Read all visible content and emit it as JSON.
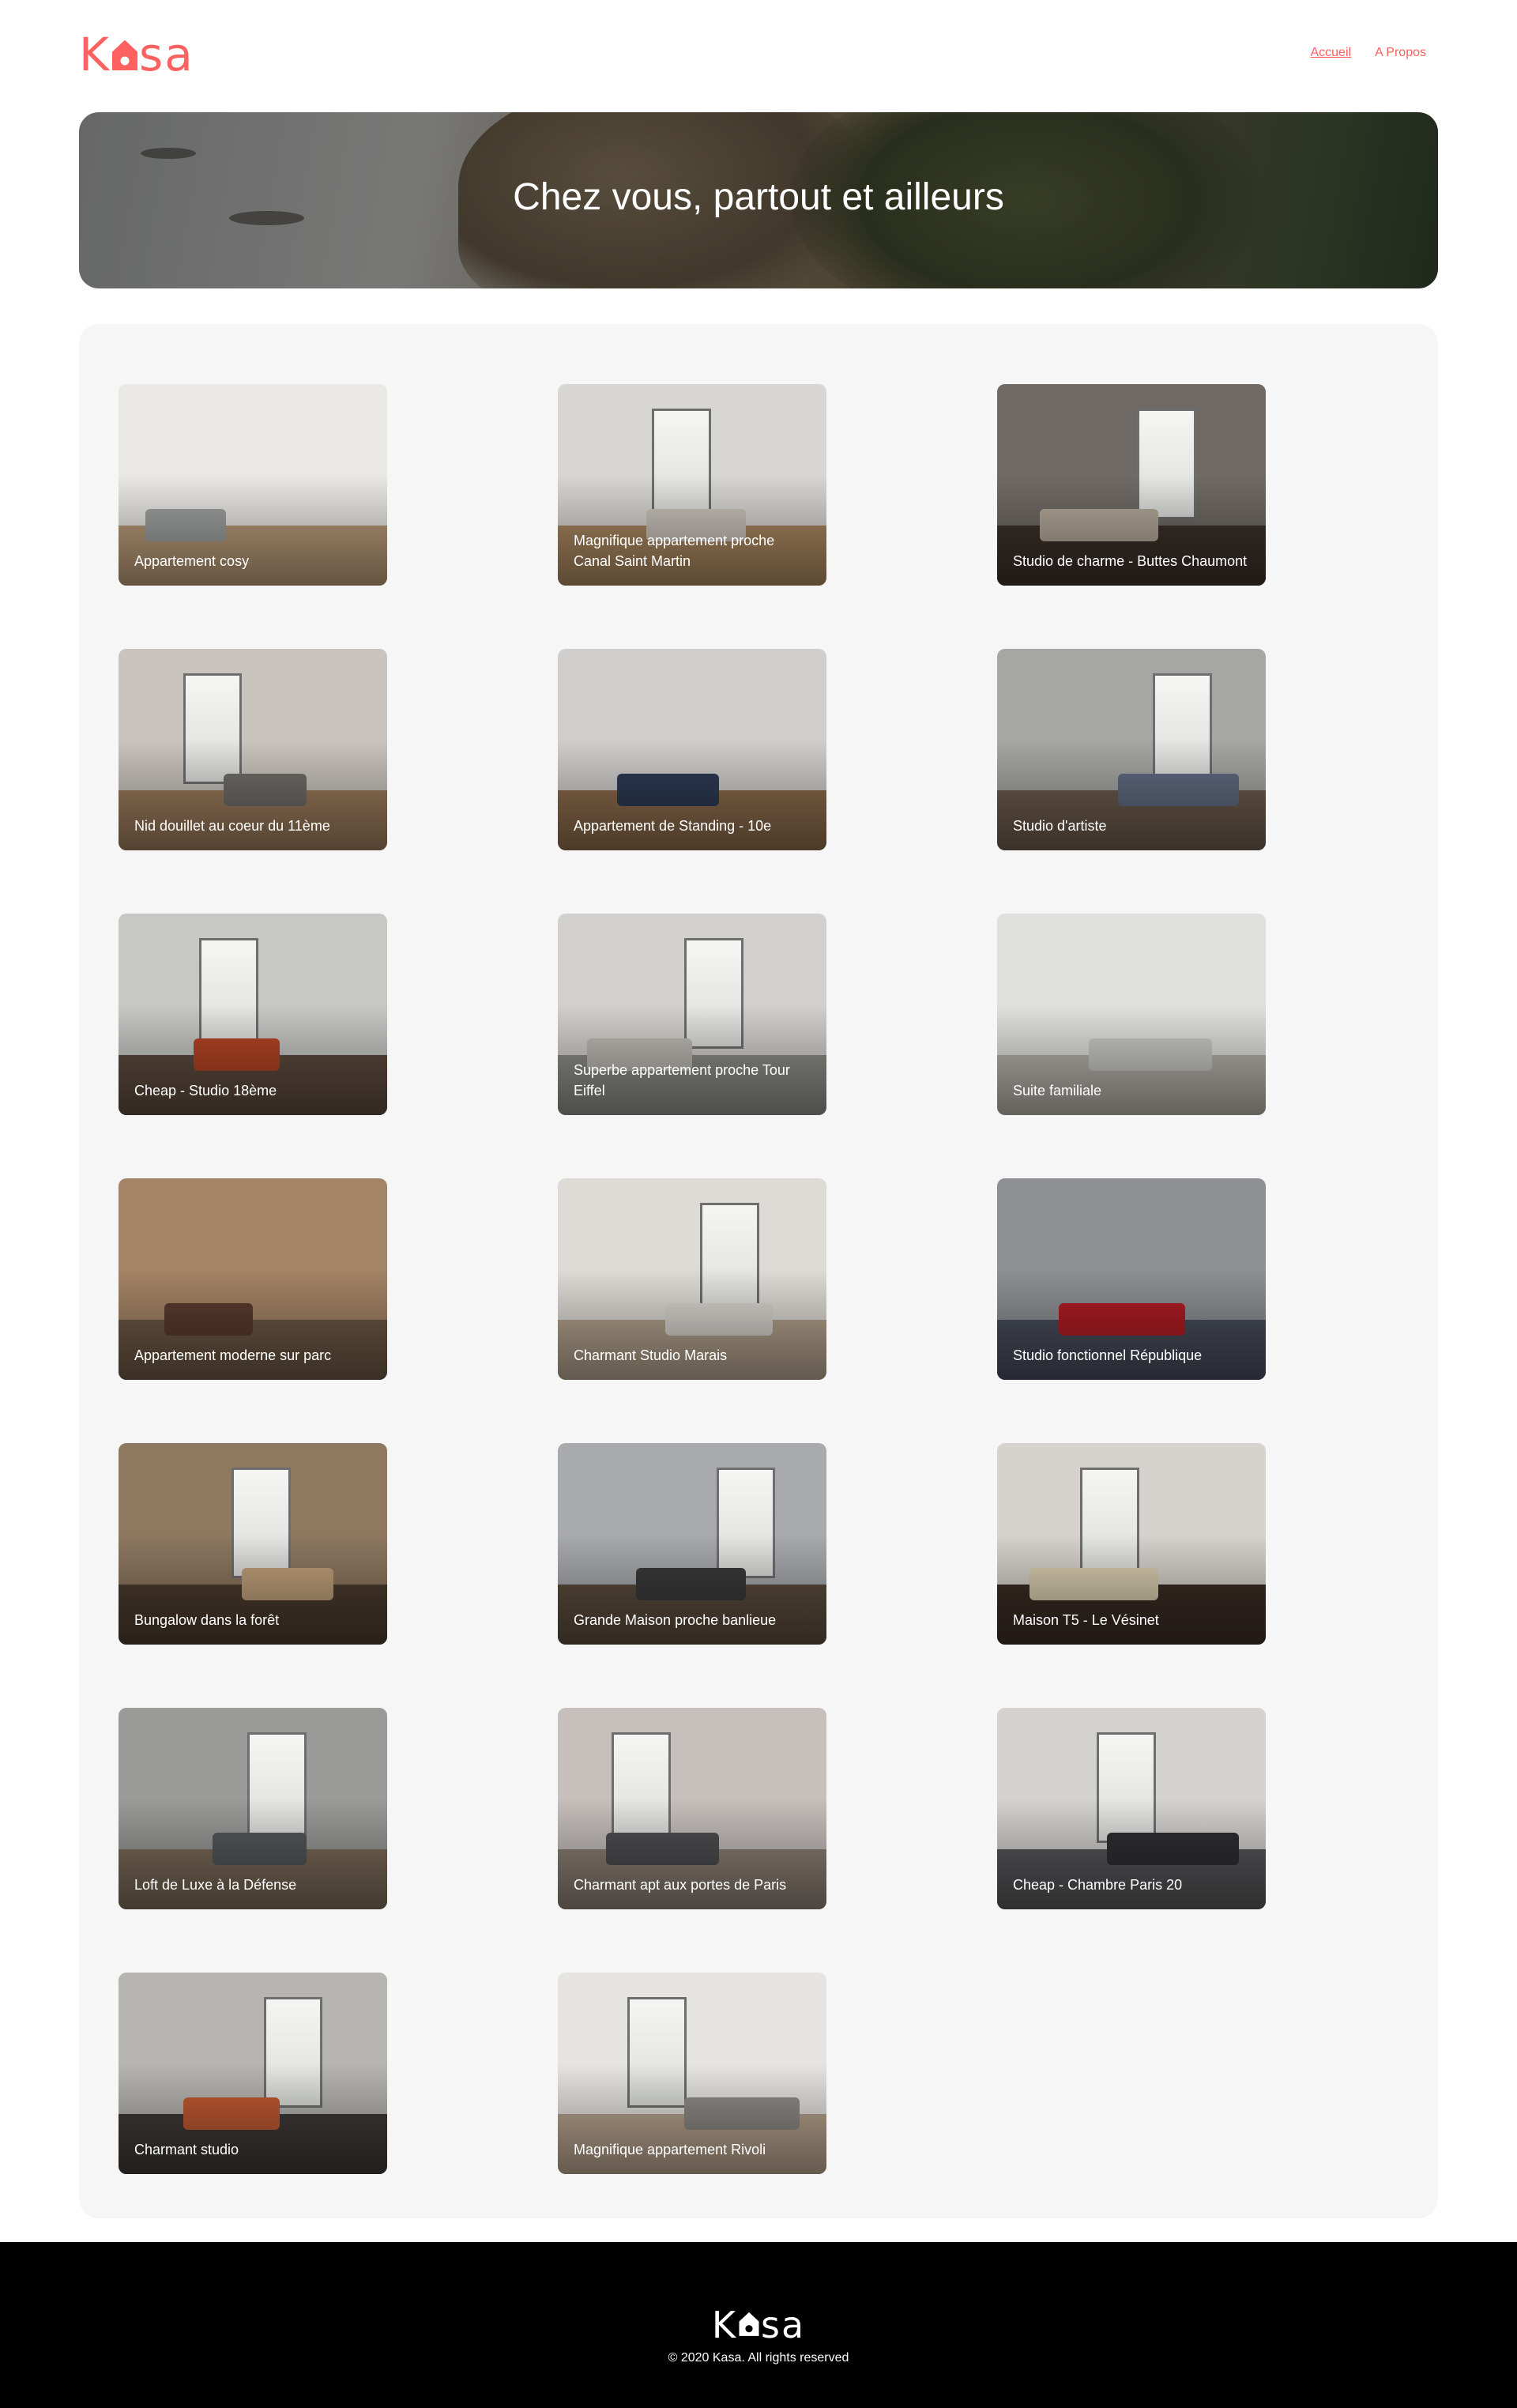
{
  "header": {
    "logo_text_k": "K",
    "logo_text_rest": "sa",
    "nav": [
      {
        "label": "Accueil",
        "active": true
      },
      {
        "label": "A Propos",
        "active": false
      }
    ]
  },
  "banner": {
    "title": "Chez vous, partout et ailleurs"
  },
  "gallery": {
    "items": [
      {
        "title": "Appartement cosy",
        "wall": "#e9e8e4",
        "floor": "#b99a78",
        "sofa": "#9ea1a0",
        "window": false
      },
      {
        "title": "Magnifique appartement proche Canal Saint Martin",
        "wall": "#d8d6d2",
        "floor": "#a8865f",
        "sofa": "#c9c3ba",
        "window": true
      },
      {
        "title": "Studio de charme - Buttes Chaumont",
        "wall": "#6f6a65",
        "floor": "#3b302a",
        "sofa": "#b3a89a",
        "window": true
      },
      {
        "title": "Nid douillet au coeur du 11ème",
        "wall": "#c9c4bd",
        "floor": "#9a7a5a",
        "sofa": "#6f6d69",
        "window": true
      },
      {
        "title": "Appartement de Standing - 10e",
        "wall": "#cfcecc",
        "floor": "#8a6a4a",
        "sofa": "#2d3a55",
        "window": false
      },
      {
        "title": "Studio d'artiste",
        "wall": "#a6a6a4",
        "floor": "#6b5a4c",
        "sofa": "#5f6b80",
        "window": true
      },
      {
        "title": "Cheap - Studio 18ème",
        "wall": "#c7c7c4",
        "floor": "#5c4a3e",
        "sofa": "#b44424",
        "window": true
      },
      {
        "title": "Superbe appartement proche Tour Eiffel",
        "wall": "#d2d0cc",
        "floor": "#8c8c86",
        "sofa": "#bdbab3",
        "window": true
      },
      {
        "title": "Suite familiale",
        "wall": "#e0e0de",
        "floor": "#b6b1aa",
        "sofa": "#c9c9c7",
        "window": false
      },
      {
        "title": "Appartement moderne sur parc",
        "wall": "#a48466",
        "floor": "#6b5743",
        "sofa": "#5a3b2e",
        "window": false
      },
      {
        "title": "Charmant Studio Marais",
        "wall": "#dedbd6",
        "floor": "#b3a28c",
        "sofa": "#d9d6d0",
        "window": true
      },
      {
        "title": "Studio fonctionnel République",
        "wall": "#8d8f93",
        "floor": "#474c5a",
        "sofa": "#b01c24",
        "window": false
      },
      {
        "title": "Bungalow dans la forêt",
        "wall": "#8e7860",
        "floor": "#4a3b2e",
        "sofa": "#c0a07a",
        "window": true
      },
      {
        "title": "Grande Maison proche banlieue",
        "wall": "#a9aaad",
        "floor": "#5a4b3c",
        "sofa": "#3a3a3a",
        "window": true
      },
      {
        "title": "Maison T5 - Le Vésinet",
        "wall": "#d6d2cd",
        "floor": "#3a2c24",
        "sofa": "#d8ceaf",
        "window": true
      },
      {
        "title": "Loft de Luxe à la Défense",
        "wall": "#9a9a98",
        "floor": "#7a6a58",
        "sofa": "#55575a",
        "window": true
      },
      {
        "title": "Charmant apt aux portes de Paris",
        "wall": "#c6bfbc",
        "floor": "#8b7f74",
        "sofa": "#4e4e50",
        "window": true
      },
      {
        "title": "Cheap - Chambre Paris 20",
        "wall": "#d4d2cf",
        "floor": "#565658",
        "sofa": "#2f2f33",
        "window": true
      },
      {
        "title": "Charmant studio",
        "wall": "#b7b5b1",
        "floor": "#3e3a36",
        "sofa": "#c25a32",
        "window": true
      },
      {
        "title": "Magnifique appartement Rivoli",
        "wall": "#e6e4e0",
        "floor": "#b8a48e",
        "sofa": "#8f8c88",
        "window": true
      }
    ]
  },
  "footer": {
    "logo_text_k": "K",
    "logo_text_rest": "sa",
    "copyright": "© 2020 Kasa. All rights reserved"
  }
}
